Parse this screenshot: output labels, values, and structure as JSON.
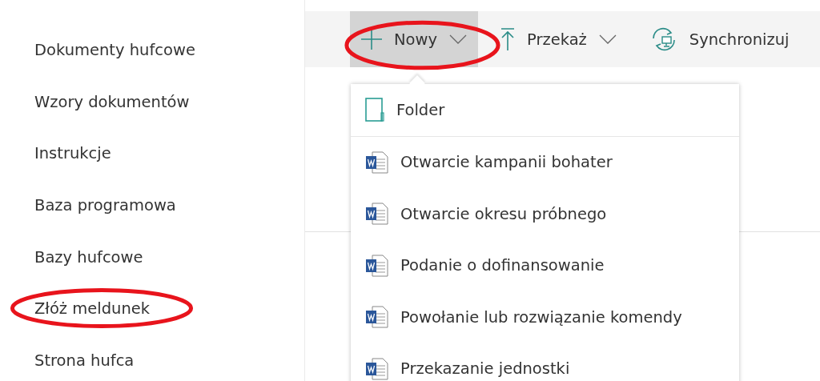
{
  "nav": {
    "items": [
      {
        "label": "Dokumenty hufcowe",
        "circled": false
      },
      {
        "label": "Wzory dokumentów",
        "circled": false
      },
      {
        "label": "Instrukcje",
        "circled": false
      },
      {
        "label": "Baza programowa",
        "circled": false
      },
      {
        "label": "Bazy hufcowe",
        "circled": false
      },
      {
        "label": "Złóż meldunek",
        "circled": true
      },
      {
        "label": "Strona hufca",
        "circled": false
      }
    ]
  },
  "toolbar": {
    "buttons": [
      {
        "kind": "plus",
        "label": "Nowy",
        "dropdown": true,
        "expanded": true,
        "circled": true
      },
      {
        "kind": "upload",
        "label": "Przekaż",
        "dropdown": true,
        "expanded": false,
        "circled": false
      },
      {
        "kind": "sync",
        "label": "Synchronizuj",
        "dropdown": false,
        "expanded": false,
        "circled": false
      }
    ]
  },
  "new_menu": {
    "items": [
      {
        "kind": "folder",
        "label": "Folder"
      },
      {
        "kind": "word",
        "label": "Otwarcie kampanii bohater"
      },
      {
        "kind": "word",
        "label": "Otwarcie okresu próbnego"
      },
      {
        "kind": "word",
        "label": "Podanie o dofinansowanie"
      },
      {
        "kind": "word",
        "label": "Powołanie lub rozwiązanie komendy"
      },
      {
        "kind": "word",
        "label": "Przekazanie jednostki"
      }
    ]
  }
}
